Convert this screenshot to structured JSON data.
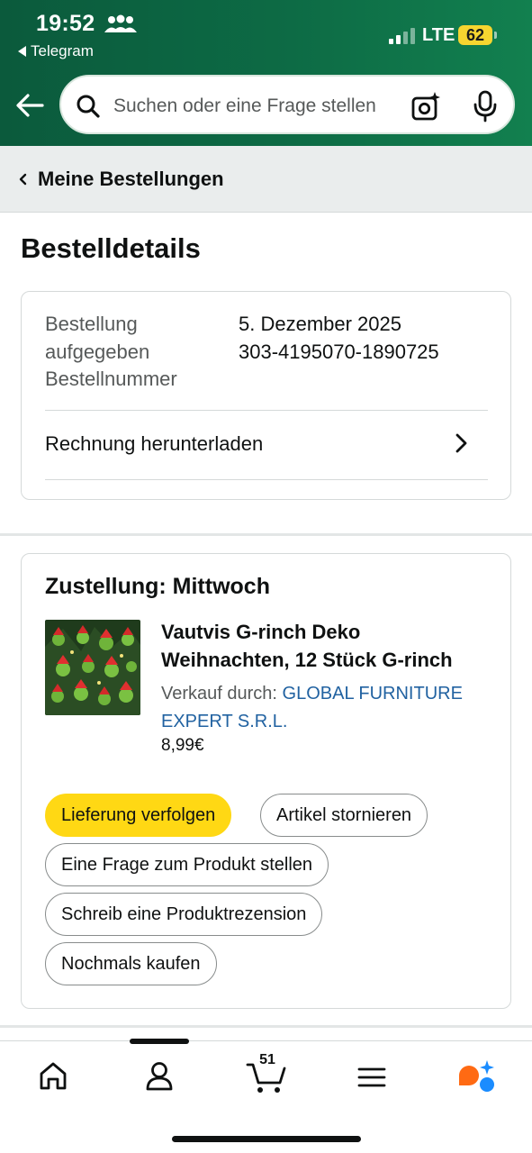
{
  "status_bar": {
    "time": "19:52",
    "back_app": "Telegram",
    "network": "LTE",
    "battery": "62",
    "icons": [
      "contacts-icon",
      "signal-icon",
      "battery-icon"
    ]
  },
  "header": {
    "search_placeholder": "Suchen oder eine Frage stellen",
    "icons": [
      "back-arrow-icon",
      "search-icon",
      "camera-scan-icon",
      "microphone-icon"
    ]
  },
  "breadcrumb": {
    "label": "Meine Bestellungen"
  },
  "page": {
    "title": "Bestelldetails"
  },
  "order": {
    "labels": [
      "Bestellung aufgegeben",
      "Bestellnummer"
    ],
    "date": "5. Dezember 2025",
    "number": "303-4195070-1890725",
    "invoice_label": "Rechnung herunterladen"
  },
  "shipment": {
    "heading": "Zustellung: Mittwoch",
    "product": {
      "title_line1": "Vautvis G-rinch Deko",
      "title_line2": "Weihnachten, 12 Stück G-rinch",
      "seller_prefix": "Verkauf durch:",
      "seller_name": "GLOBAL FURNITURE EXPERT S.R.L.",
      "price": "8,99€"
    },
    "actions": [
      "Lieferung verfolgen",
      "Artikel stornieren",
      "Eine Frage zum Produkt stellen",
      "Schreib eine Produktrezension",
      "Nochmals kaufen"
    ]
  },
  "tab_bar": {
    "tabs": [
      "home-icon",
      "account-icon",
      "cart-icon",
      "menu-icon",
      "assistant-icon"
    ],
    "cart_count": "51"
  },
  "colors": {
    "header_green": "#0d6b45",
    "primary_button": "#ffd814",
    "link": "#2162a1",
    "assistant_orange": "#ff6a13",
    "assistant_blue": "#1a8cff"
  }
}
